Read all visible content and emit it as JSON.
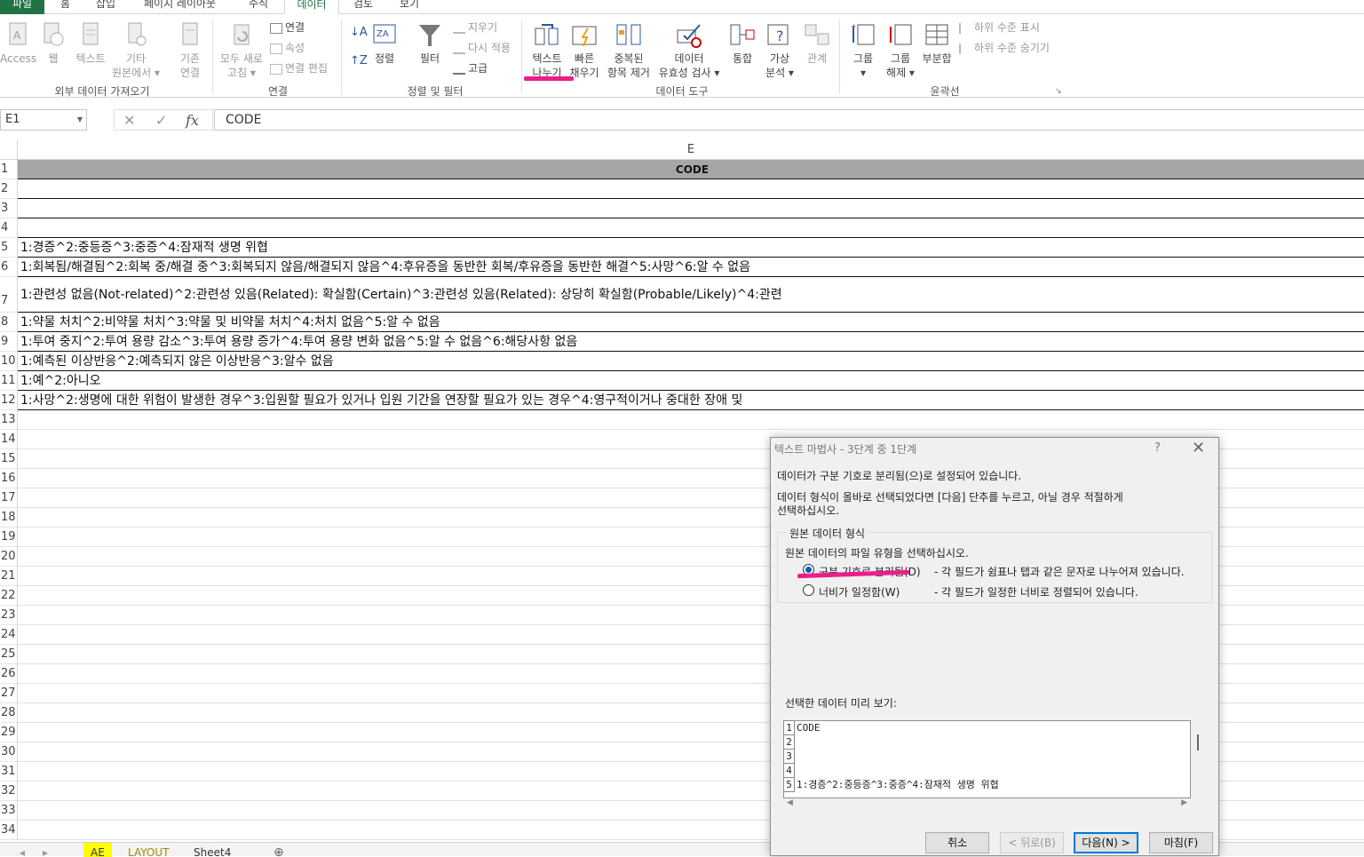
{
  "tabs": [
    {
      "label": "파일"
    },
    {
      "label": "홈"
    },
    {
      "label": "삽입"
    },
    {
      "label": "페이지 레이아웃"
    },
    {
      "label": "수식"
    },
    {
      "label": "데이터"
    },
    {
      "label": "검토"
    },
    {
      "label": "보기"
    }
  ],
  "ribbon": {
    "ext": {
      "access": "Access",
      "web": "웹",
      "text": "텍스트",
      "other1": "기타",
      "other2": "원본에서 ▾",
      "existing1": "기존",
      "existing2": "연결",
      "group": "외부 데이터 가져오기"
    },
    "conn": {
      "refresh1": "모두 새로",
      "refresh2": "고침 ▾",
      "connections": "연결",
      "properties": "속성",
      "edit_links": "연결 편집",
      "group": "연결"
    },
    "sort": {
      "sort": "정렬",
      "filter": "필터",
      "clear": "지우기",
      "reapply": "다시 적용",
      "advanced": "고급",
      "group": "정렬 및 필터"
    },
    "tools": {
      "ttc1": "텍스트",
      "ttc2": "나누기",
      "flash1": "빠른",
      "flash2": "채우기",
      "dup1": "중복된",
      "dup2": "항목 제거",
      "valid1": "데이터",
      "valid2": "유효성 검사 ▾",
      "consolidate": "통합",
      "whatif1": "가상",
      "whatif2": "분석 ▾",
      "relations": "관계",
      "group": "데이터 도구"
    },
    "outline": {
      "group1": "그룹",
      "group2": "▾",
      "ungroup1": "그룹",
      "ungroup2": "해제 ▾",
      "subtotal": "부분합",
      "show": "하위 수준 표시",
      "hide": "하위 수준 숨기기",
      "group_label": "윤곽선"
    }
  },
  "formula_bar": {
    "namebox": "E1",
    "value": "CODE",
    "fx": "fx"
  },
  "sheet": {
    "column_letter": "E",
    "rows": [
      {
        "num": "1",
        "text": "CODE"
      },
      {
        "num": "2",
        "text": ""
      },
      {
        "num": "3",
        "text": ""
      },
      {
        "num": "4",
        "text": ""
      },
      {
        "num": "5",
        "text": "1:경증^2:중등증^3:중증^4:잠재적 생명 위협"
      },
      {
        "num": "6",
        "text": "1:회복됨/해결됨^2:회복 중/해결 중^3:회복되지 않음/해결되지 않음^4:후유증을 동반한 회복/후유증을 동반한 해결^5:사망^6:알 수 없음"
      },
      {
        "num": "7",
        "text": "1:관련성 없음(Not-related)^2:관련성 있음(Related): 확실함(Certain)^3:관련성 있음(Related): 상당히 확실함(Probable/Likely)^4:관련"
      },
      {
        "num": "8",
        "text": "1:약물 처치^2:비약물 처치^3:약물 및 비약물 처치^4:처치 없음^5:알 수 없음"
      },
      {
        "num": "9",
        "text": "1:투여 중지^2:투여 용량 감소^3:투여 용량 증가^4:투여 용량 변화 없음^5:알 수 없음^6:해당사항 없음"
      },
      {
        "num": "10",
        "text": "1:예측된 이상반응^2:예측되지 않은 이상반응^3:알수 없음"
      },
      {
        "num": "11",
        "text": "1:예^2:아니오"
      },
      {
        "num": "12",
        "text": "1:사망^2:생명에 대한 위험이 발생한 경우^3:입원할 필요가 있거나 입원 기간을 연장할 필요가 있는 경우^4:영구적이거나 중대한 장애 및"
      },
      {
        "num": "13",
        "text": ""
      },
      {
        "num": "14",
        "text": ""
      },
      {
        "num": "15",
        "text": ""
      },
      {
        "num": "16",
        "text": ""
      },
      {
        "num": "17",
        "text": ""
      },
      {
        "num": "18",
        "text": ""
      },
      {
        "num": "19",
        "text": ""
      },
      {
        "num": "20",
        "text": ""
      },
      {
        "num": "21",
        "text": ""
      },
      {
        "num": "22",
        "text": ""
      },
      {
        "num": "23",
        "text": ""
      },
      {
        "num": "24",
        "text": ""
      },
      {
        "num": "25",
        "text": ""
      },
      {
        "num": "26",
        "text": ""
      },
      {
        "num": "27",
        "text": ""
      },
      {
        "num": "28",
        "text": ""
      },
      {
        "num": "29",
        "text": ""
      },
      {
        "num": "30",
        "text": ""
      },
      {
        "num": "31",
        "text": ""
      },
      {
        "num": "32",
        "text": ""
      },
      {
        "num": "33",
        "text": ""
      },
      {
        "num": "34",
        "text": ""
      }
    ]
  },
  "sheet_tabs": [
    {
      "label": "AE"
    },
    {
      "label": "LAYOUT"
    },
    {
      "label": "Sheet4"
    }
  ],
  "add_sheet": "⊕",
  "dialog": {
    "title": "텍스트 마법사 - 3단계 중 1단계",
    "help": "?",
    "close": "✕",
    "line1": "데이터가 구분 기호로 분리됨(으)로 설정되어 있습니다.",
    "line2": "데이터 형식이 올바로 선택되었다면 [다음] 단추를 누르고, 아닐 경우 적절하게",
    "line3": "선택하십시오.",
    "legend": "원본 데이터 형식",
    "prompt": "원본 데이터의 파일 유형을 선택하십시오.",
    "opt1_label": "구분 기호로 분리됨(D)",
    "opt1_desc": "- 각 필드가 쉼표나 탭과 같은 문자로 나누어져 있습니다.",
    "opt2_label": "너비가 일정함(W)",
    "opt2_desc": "- 각 필드가 일정한 너비로 정렬되어 있습니다.",
    "preview_label": "선택한 데이터 미리 보기:",
    "preview_nums": [
      "1",
      "2",
      "3",
      "4",
      "5"
    ],
    "preview_rows": [
      "CODE",
      "",
      "",
      "",
      "1:경증^2:중등증^3:중증^4:잠재적 생명 위협"
    ],
    "btn_cancel": "취소",
    "btn_back": "< 뒤로(B)",
    "btn_next": "다음(N) >",
    "btn_finish": "마침(F)"
  }
}
